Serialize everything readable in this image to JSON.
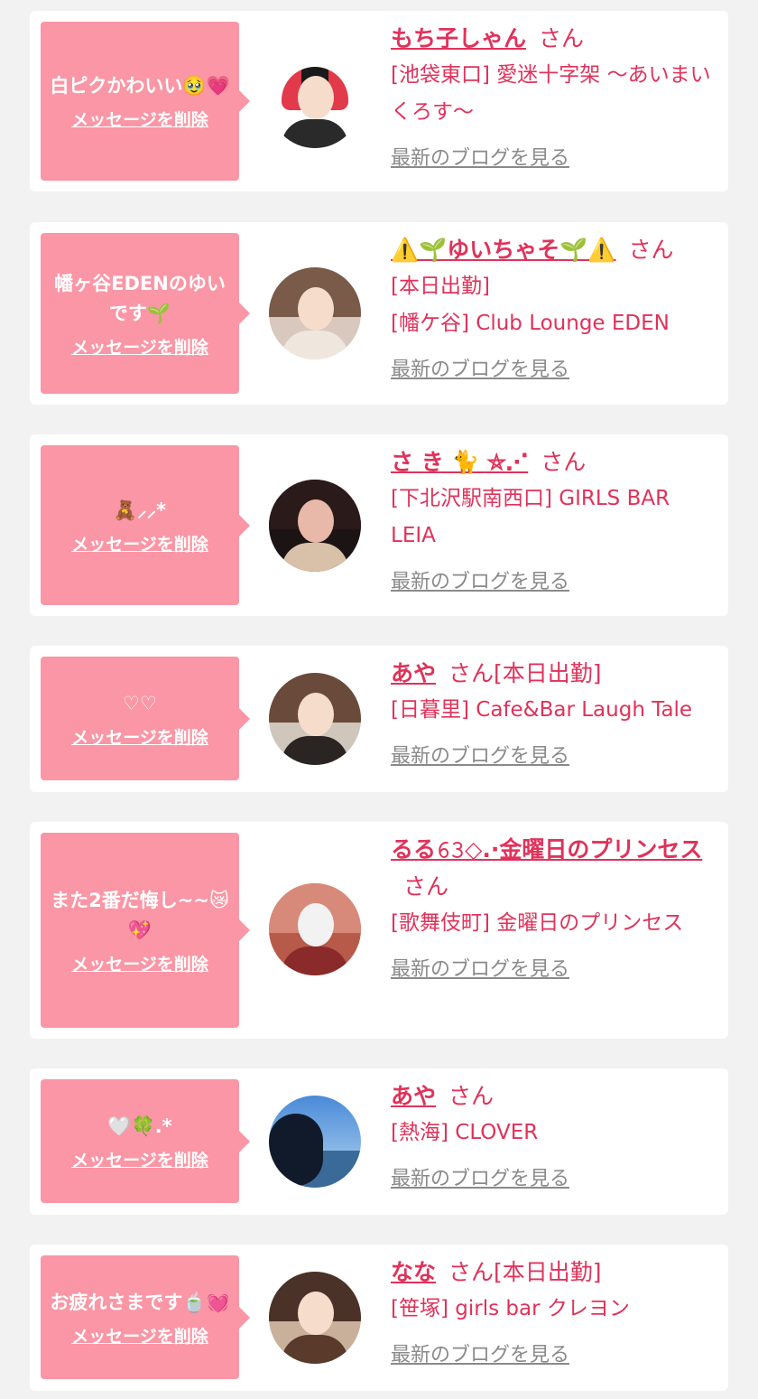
{
  "common": {
    "delete_label": "メッセージを削除",
    "blog_label": "最新のブログを見る"
  },
  "colors": {
    "bubble": "#fa96a5",
    "accent": "#e0325a",
    "link_gray": "#8a8a8a",
    "page_bg": "#f2f2f2"
  },
  "messages": [
    {
      "bubble_text": "白ピクかわいい🥹💗",
      "name": "もち子しゃん",
      "suffix": "さん",
      "shop": "[池袋東口] 愛迷十字架 〜あいまいくろす〜"
    },
    {
      "bubble_text": "幡ヶ谷EDENのゆいです🌱",
      "name": "⚠️🌱ゆいちゃそ🌱⚠️",
      "suffix": "さん",
      "status": "[本日出勤]",
      "shop": "[幡ケ谷] Club Lounge EDEN"
    },
    {
      "bubble_text": "🧸⸝⸝*",
      "name": "さ き 🐈 ⛤⋰",
      "suffix": "さん",
      "shop": "[下北沢駅南西口] GIRLS BAR LEIA"
    },
    {
      "bubble_text": "♡♡",
      "name": "あや",
      "suffix": "さん[本日出勤]",
      "shop": "[日暮里] Cafe&Bar Laugh Tale"
    },
    {
      "bubble_text": "また2番だ悔し~~😿💖",
      "name": "るる𝟼𝟹◇.·金曜日のプリンセス",
      "suffix": "さん",
      "shop": "[歌舞伎町] 金曜日のプリンセス"
    },
    {
      "bubble_text": "🤍🍀.*",
      "name": "あや",
      "suffix": "さん",
      "shop": "[熱海] CLOVER"
    },
    {
      "bubble_text": "お疲れさまです🍵💓",
      "name": "なな",
      "suffix": "さん[本日出勤]",
      "shop": "[笹塚] girls bar クレヨン"
    }
  ]
}
